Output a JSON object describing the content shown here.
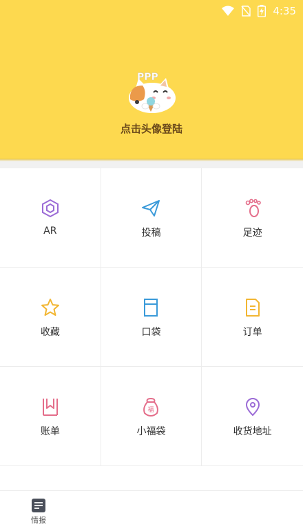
{
  "status_bar": {
    "time": "4:35",
    "icons": [
      "wifi-icon",
      "no-sim-icon",
      "battery-charging-icon"
    ]
  },
  "profile": {
    "avatar": "cat-avatar",
    "login_label": "点击头像登陆"
  },
  "grid": {
    "items": [
      {
        "label": "AR",
        "icon": "ar-icon",
        "color": "#9b6bd6"
      },
      {
        "label": "投稿",
        "icon": "paper-plane-icon",
        "color": "#3a9ad9"
      },
      {
        "label": "足迹",
        "icon": "footprint-icon",
        "color": "#e46d8a"
      },
      {
        "label": "收藏",
        "icon": "star-icon",
        "color": "#f2b632"
      },
      {
        "label": "口袋",
        "icon": "pocket-icon",
        "color": "#3a9ad9"
      },
      {
        "label": "订单",
        "icon": "order-icon",
        "color": "#f2b632"
      },
      {
        "label": "账单",
        "icon": "bill-icon",
        "color": "#e46d8a"
      },
      {
        "label": "小福袋",
        "icon": "lucky-bag-icon",
        "color": "#e46d8a"
      },
      {
        "label": "收货地址",
        "icon": "location-pin-icon",
        "color": "#9b6bd6"
      }
    ]
  },
  "bottom_nav": {
    "items": [
      {
        "label": "情报",
        "icon": "news-icon"
      }
    ]
  },
  "colors": {
    "header_bg": "#fdd94f",
    "login_text": "#6b4a1b"
  }
}
